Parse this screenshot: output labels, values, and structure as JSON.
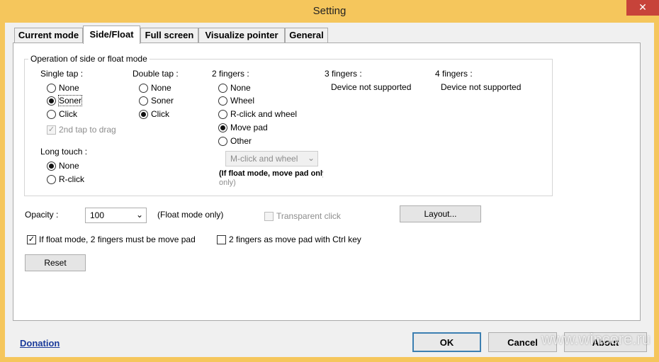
{
  "window": {
    "title": "Setting",
    "close_glyph": "✕"
  },
  "tabs": [
    {
      "label": "Current mode"
    },
    {
      "label": "Side/Float",
      "active": true
    },
    {
      "label": "Full screen"
    },
    {
      "label": "Visualize pointer"
    },
    {
      "label": "General"
    }
  ],
  "group": {
    "title": "Operation of side or float mode",
    "single_tap": {
      "label": "Single tap :",
      "options": [
        "None",
        "Soner",
        "Click"
      ],
      "selected": "Soner",
      "second_tap_label": "2nd tap to drag",
      "second_tap_checked": true
    },
    "double_tap": {
      "label": "Double tap :",
      "options": [
        "None",
        "Soner",
        "Click"
      ],
      "selected": "Click"
    },
    "two_fingers": {
      "label": "2 fingers :",
      "options": [
        "None",
        "Wheel",
        "R-click and wheel",
        "Move pad",
        "Other"
      ],
      "selected": "Move pad",
      "other_select": "M-click and wheel",
      "note_line1": "(If float mode, move pad only",
      "note_line2": "only)"
    },
    "three_fingers": {
      "label": "3 fingers :",
      "status": "Device not supported"
    },
    "four_fingers": {
      "label": "4 fingers :",
      "status": "Device not supported"
    },
    "long_touch": {
      "label": "Long touch :",
      "options": [
        "None",
        "R-click"
      ],
      "selected": "None"
    }
  },
  "opacity": {
    "label": "Opacity :",
    "value": "100",
    "note": "(Float mode only)"
  },
  "transparent_click": {
    "label": "Transparent click",
    "checked": false
  },
  "layout_button": "Layout...",
  "float_move_pad": {
    "label": "If float mode, 2 fingers must be move pad",
    "checked": true
  },
  "ctrl_move_pad": {
    "label": "2 fingers as move pad with Ctrl key",
    "checked": false
  },
  "reset_button": "Reset",
  "footer": {
    "donation": "Donation",
    "ok": "OK",
    "cancel": "Cancel",
    "about": "About"
  },
  "watermark": "www.wincore.ru"
}
